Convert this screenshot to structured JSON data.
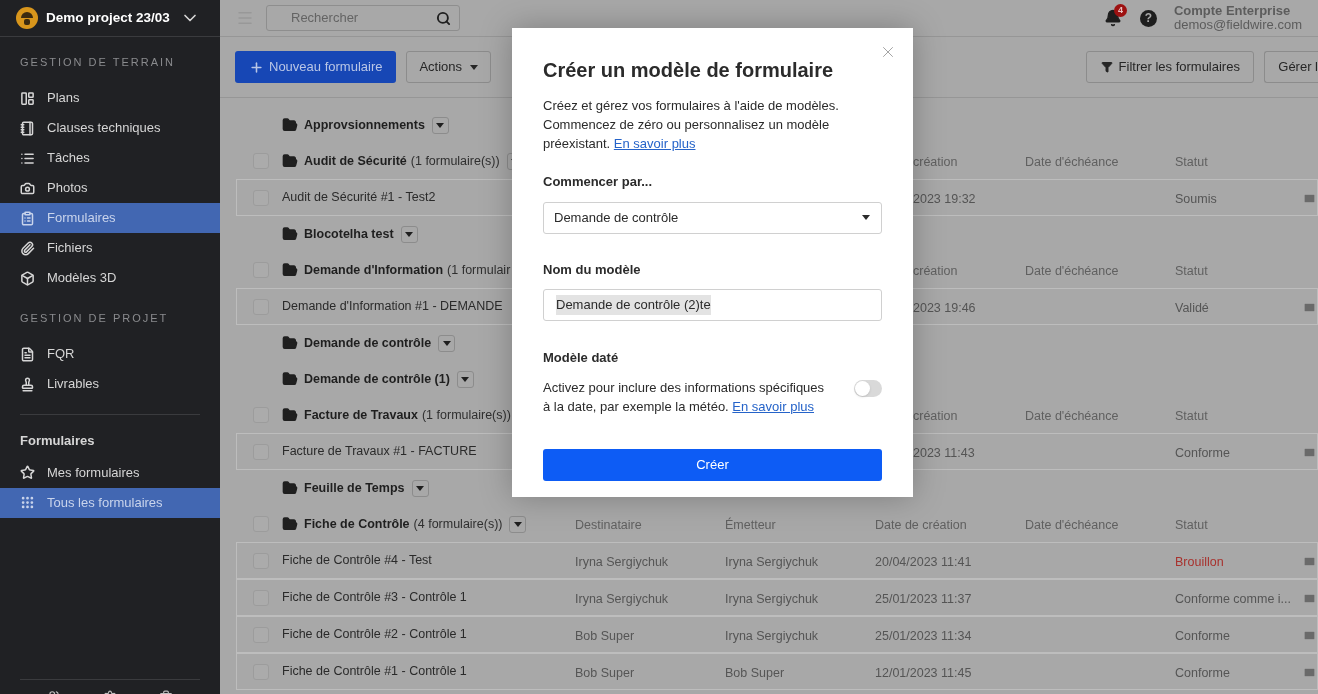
{
  "project": {
    "name": "Demo project 23/03"
  },
  "sidebar": {
    "sections": [
      {
        "title": "GESTION DE TERRAIN",
        "items": [
          {
            "label": "Plans",
            "selected": false
          },
          {
            "label": "Clauses techniques",
            "selected": false
          },
          {
            "label": "Tâches",
            "selected": false
          },
          {
            "label": "Photos",
            "selected": false
          },
          {
            "label": "Formulaires",
            "selected": true
          },
          {
            "label": "Fichiers",
            "selected": false
          },
          {
            "label": "Modèles 3D",
            "selected": false
          }
        ]
      },
      {
        "title": "GESTION DE PROJET",
        "items": [
          {
            "label": "FQR",
            "selected": false
          },
          {
            "label": "Livrables",
            "selected": false
          }
        ]
      }
    ],
    "forms_section": {
      "title": "Formulaires",
      "items": [
        {
          "label": "Mes formulaires",
          "selected": false
        },
        {
          "label": "Tous les formulaires",
          "selected": true
        }
      ]
    }
  },
  "topbar": {
    "search_placeholder": "Rechercher",
    "notifications": "4",
    "help": "?",
    "account": "Compte Enterprise",
    "email": "demos@fieldwire.com"
  },
  "toolbar": {
    "new_button": "Nouveau formulaire",
    "actions_button": "Actions",
    "filter_button": "Filtrer les formulaires",
    "manage_button": "Gérer l"
  },
  "groups": [
    {
      "name": "Approvsionnements",
      "menu": true
    },
    {
      "name": "Audit de Sécurité",
      "count": "(1 formulaire(s))",
      "checked": false,
      "menu": true,
      "columns": [
        {
          "kind": "created",
          "label": "création"
        },
        {
          "kind": "due",
          "label": "Date d'échéance"
        },
        {
          "kind": "status",
          "label": "Statut"
        }
      ],
      "items": [
        {
          "name": "Audit de Sécurité #1 - Test2",
          "checked": false,
          "created": "2023 19:32",
          "status": "Soumis"
        }
      ]
    },
    {
      "name": "Blocotelha test",
      "menu": true
    },
    {
      "name": "Demande d'Information",
      "count": "(1 formulair",
      "checked": false,
      "menu": false,
      "columns": [
        {
          "kind": "created",
          "label": "création"
        },
        {
          "kind": "due",
          "label": "Date d'échéance"
        },
        {
          "kind": "status",
          "label": "Statut"
        }
      ],
      "items": [
        {
          "name": "Demande d'Information #1 - DEMANDE",
          "checked": false,
          "created": "2023 19:46",
          "status": "Validé"
        }
      ]
    },
    {
      "name": "Demande de contrôle",
      "menu": true
    },
    {
      "name": "Demande de contrôle (1)",
      "menu": true
    },
    {
      "name": "Facture de Travaux",
      "count": "(1 formulaire(s))",
      "checked": false,
      "menu": false,
      "columns": [
        {
          "kind": "created",
          "label": "création"
        },
        {
          "kind": "due",
          "label": "Date d'échéance"
        },
        {
          "kind": "status",
          "label": "Statut"
        }
      ],
      "items": [
        {
          "name": "Facture de Travaux #1 - FACTURE",
          "checked": false,
          "created": "2023 11:43",
          "status": "Conforme"
        }
      ]
    },
    {
      "name": "Feuille de Temps",
      "menu": true
    },
    {
      "name": "Fiche de Contrôle",
      "count": "(4 formulaire(s))",
      "checked": false,
      "menu": true,
      "columns": [
        {
          "kind": "recipient",
          "label": "Destinataire"
        },
        {
          "kind": "sender",
          "label": "Émetteur"
        },
        {
          "kind": "created",
          "label": "Date de création"
        },
        {
          "kind": "due",
          "label": "Date d'échéance"
        },
        {
          "kind": "status",
          "label": "Statut"
        }
      ],
      "items": [
        {
          "name": "Fiche de Contrôle #4 - Test",
          "checked": false,
          "recipient": "Iryna Sergiychuk",
          "sender": "Iryna Sergiychuk",
          "created": "20/04/2023 11:41",
          "status": "Brouillon",
          "color": "#a8322e"
        },
        {
          "name": "Fiche de Contrôle #3 - Contrôle 1",
          "checked": false,
          "recipient": "Iryna Sergiychuk",
          "sender": "Iryna Sergiychuk",
          "created": "25/01/2023 11:37",
          "status": "Conforme comme i..."
        },
        {
          "name": "Fiche de Contrôle #2 - Contrôle 1",
          "checked": false,
          "recipient": "Bob Super",
          "sender": "Iryna Sergiychuk",
          "created": "25/01/2023 11:34",
          "status": "Conforme"
        },
        {
          "name": "Fiche de Contrôle #1 - Contrôle 1",
          "checked": false,
          "recipient": "Bob Super",
          "sender": "Bob Super",
          "created": "12/01/2023 11:45",
          "status": "Conforme"
        }
      ]
    }
  ],
  "modal": {
    "title": "Créer un modèle de formulaire",
    "description": "Créez et gérez vos formulaires à l'aide de modèles. Commencez de zéro ou personnalisez un modèle préexistant.",
    "description_link": "En savoir plus",
    "start_label": "Commencer par...",
    "start_value": "Demande de contrôle",
    "name_label": "Nom du modèle",
    "name_value": "Demande de contrôle (2)te",
    "dated": {
      "label": "Modèle daté",
      "description": "Activez pour inclure des informations spécifiques à la date, par exemple la météo.",
      "link": "En savoir plus",
      "on": false
    },
    "submit": "Créer"
  }
}
